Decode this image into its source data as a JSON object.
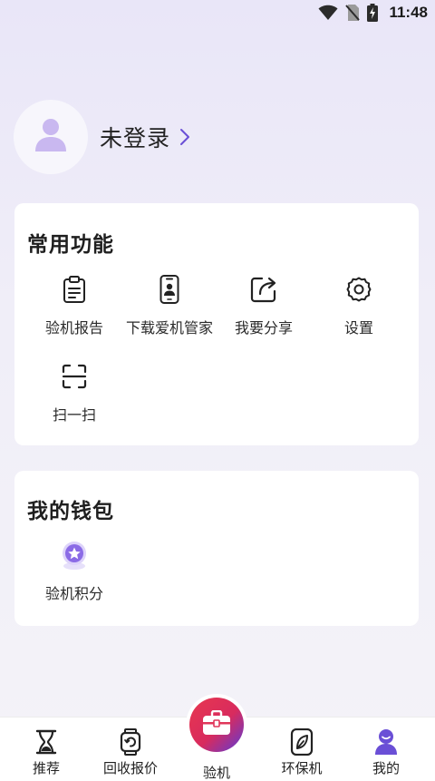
{
  "status_bar": {
    "time": "11:48",
    "icons": [
      "wifi-icon",
      "no-sim-icon",
      "battery-charging-icon"
    ]
  },
  "profile": {
    "login_text": "未登录",
    "avatar_icon": "user-avatar-icon",
    "chevron_icon": "chevron-right-icon"
  },
  "common_functions": {
    "title": "常用功能",
    "items": [
      {
        "label": "验机报告",
        "icon": "clipboard-report-icon"
      },
      {
        "label": "下载爱机管家",
        "icon": "phone-download-icon"
      },
      {
        "label": "我要分享",
        "icon": "share-icon"
      },
      {
        "label": "设置",
        "icon": "gear-icon"
      },
      {
        "label": "扫一扫",
        "icon": "scan-icon"
      }
    ]
  },
  "wallet": {
    "title": "我的钱包",
    "items": [
      {
        "label": "验机积分",
        "icon": "star-badge-icon"
      }
    ]
  },
  "bottom_nav": {
    "items": [
      {
        "label": "推荐",
        "icon": "hourglass-icon"
      },
      {
        "label": "回收报价",
        "icon": "watch-recycle-icon"
      },
      {
        "label": "验机",
        "icon": "briefcase-icon"
      },
      {
        "label": "环保机",
        "icon": "leaf-icon"
      },
      {
        "label": "我的",
        "icon": "profile-icon",
        "active": true
      }
    ]
  },
  "colors": {
    "accent": "#7b5ce0",
    "background": "#efedf8",
    "card": "#ffffff",
    "center_gradient_start": "#e8374f",
    "center_gradient_end": "#5a3bd8"
  }
}
